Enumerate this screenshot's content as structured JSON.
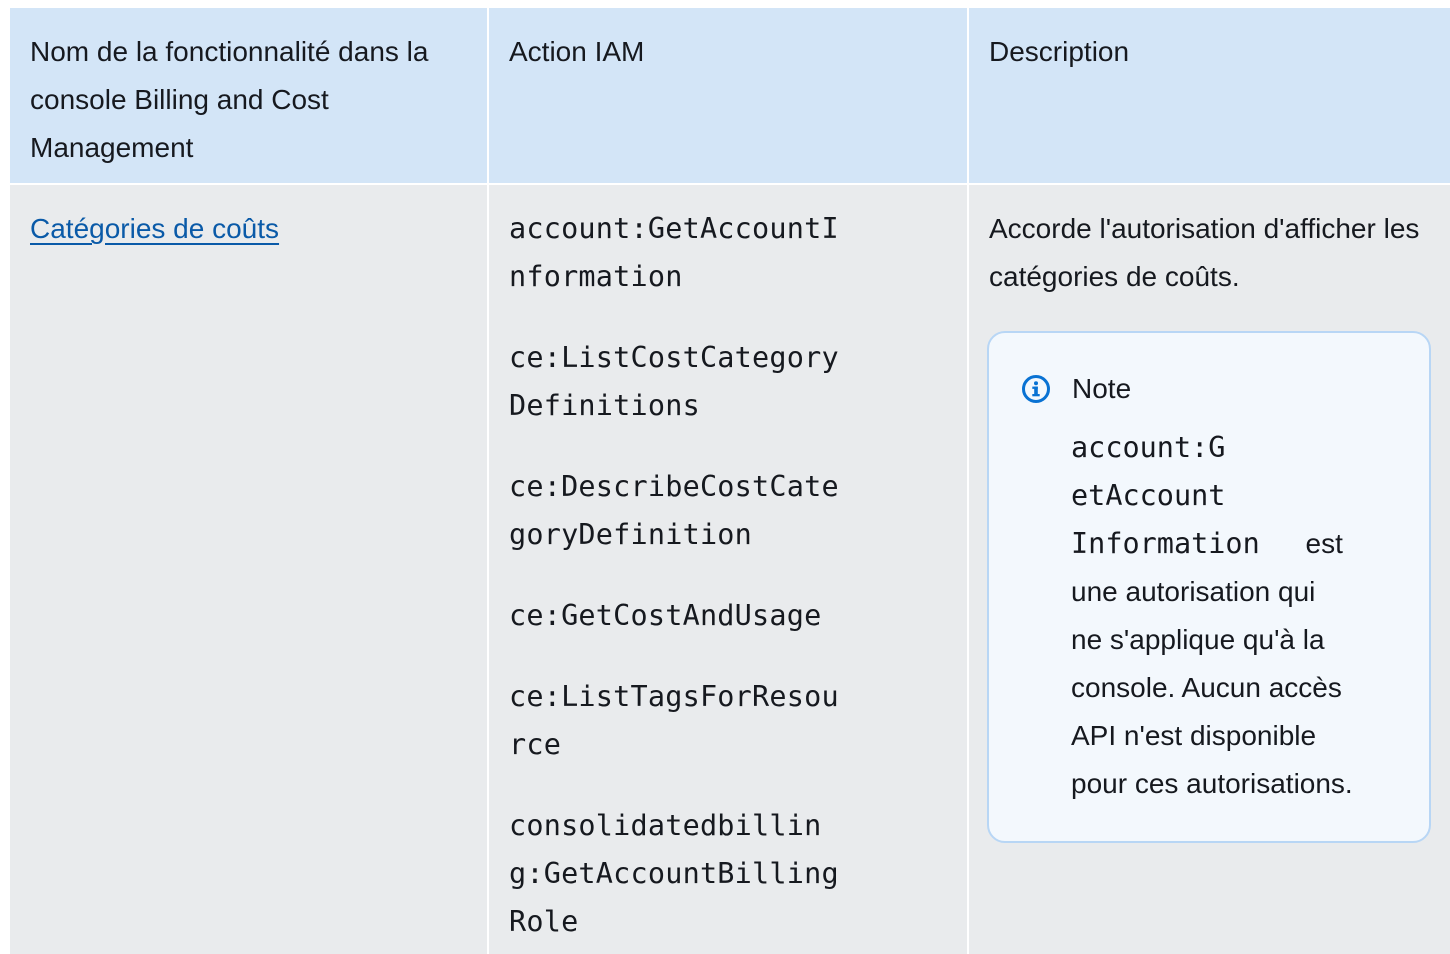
{
  "table": {
    "headers": [
      "Nom de la fonctionnalité dans la console Billing and Cost Management",
      "Action IAM",
      "Description"
    ],
    "rows": [
      {
        "feature_link": "Catégories de coûts",
        "actions": [
          "account:GetAccountInformation",
          "ce:ListCostCategoryDefinitions",
          "ce:DescribeCostCategoryDefinition",
          "ce:GetCostAndUsage",
          "ce:ListTagsForResource",
          "consolidatedbilling:GetAccountBillingRole"
        ],
        "description": "Accorde l'autorisation d'afficher les catégories de coûts.",
        "note": {
          "title": "Note",
          "code_line_1": "account:G",
          "code_line_2": "etAccount",
          "code_line_3": "Information",
          "text_line_1": "est",
          "text_line_2": "une autorisation qui",
          "text_line_3": "ne s'applique qu'à la",
          "text_line_4": "console. Aucun accès",
          "text_line_5": "API n'est disponible",
          "text_line_6": "pour ces autorisations."
        }
      }
    ]
  },
  "colors": {
    "header_bg": "#d3e5f7",
    "row_bg": "#e9ebed",
    "link": "#0a5aa8",
    "note_border": "#b8d6f5",
    "note_bg": "#f3f8fd",
    "info_icon": "#0972d3"
  },
  "icons": {
    "note": "info-circle-icon"
  }
}
